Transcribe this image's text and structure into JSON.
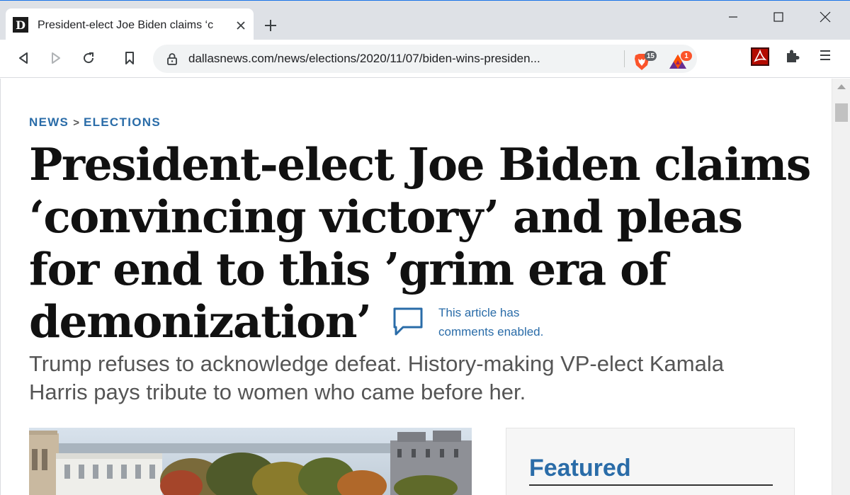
{
  "browser": {
    "tab": {
      "favicon_letter": "D",
      "title": "President-elect Joe Biden claims ‘c"
    },
    "url": "dallasnews.com/news/elections/2020/11/07/biden-wins-presiden...",
    "extensions": {
      "brave_shields_count": "15",
      "brave_rewards_count": "1"
    },
    "icons": {
      "back": "arrow-left-icon",
      "forward": "arrow-right-icon",
      "reload": "reload-icon",
      "bookmark": "bookmark-icon",
      "lock": "lock-icon",
      "close_tab": "close-icon",
      "new_tab": "plus-icon",
      "extensions": "puzzle-icon",
      "menu": "menu-icon"
    },
    "colors": {
      "accent": "#1a73e8",
      "link": "#2a6ca8",
      "brave_orange": "#fb542b",
      "rewards_purple": "#662d91",
      "acrobat_red": "#b30b00"
    }
  },
  "article": {
    "breadcrumb": {
      "section": "NEWS",
      "separator": ">",
      "subsection": "ELECTIONS"
    },
    "headline": "President-elect Joe Biden claims ‘convincing victory’ and pleas for end to this ’grim era of demonization’",
    "comments": {
      "line1": "This article has",
      "line2": "comments enabled."
    },
    "dek": "Trump refuses to acknowledge defeat. History-making VP-elect Kamala Harris pays tribute to women who came before her.",
    "sidebar": {
      "featured_title": "Featured"
    }
  }
}
